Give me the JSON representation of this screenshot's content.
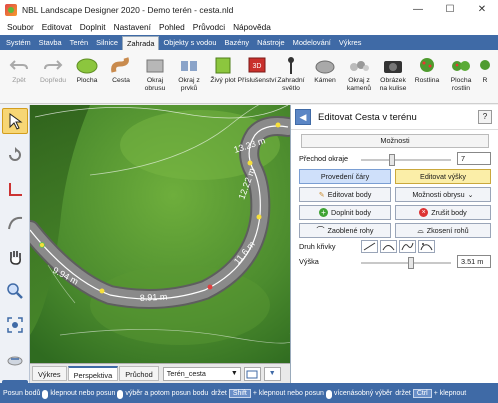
{
  "window": {
    "title": "NBL Landscape Designer 2020 - Demo terén - cesta.nld",
    "min_icon": "minimize-icon",
    "max_icon": "maximize-icon",
    "close_icon": "close-icon"
  },
  "menu": [
    "Soubor",
    "Editovat",
    "Doplnit",
    "Nastavení",
    "Pohled",
    "Průvodci",
    "Nápověda"
  ],
  "ribbon_tabs": [
    "Systém",
    "Stavba",
    "Terén",
    "Silnice",
    "Zahrada",
    "Objekty s vodou",
    "Bazény",
    "Nástroje",
    "Modelování",
    "Výkres"
  ],
  "active_ribbon_tab": "Zahrada",
  "toolbar": [
    {
      "label": "Zpět",
      "icon": "undo-icon",
      "disabled": true
    },
    {
      "label": "Dopředu",
      "icon": "redo-icon",
      "disabled": true
    },
    {
      "label": "Plocha",
      "icon": "area-icon"
    },
    {
      "label": "Cesta",
      "icon": "path-icon"
    },
    {
      "label": "Okraj obrusu",
      "icon": "curb-icon"
    },
    {
      "label": "Okraj z prvků",
      "icon": "edge-elements-icon"
    },
    {
      "label": "Živý plot",
      "icon": "hedge-icon"
    },
    {
      "label": "Příslušenství",
      "icon": "accessories-icon"
    },
    {
      "label": "Zahradní světlo",
      "icon": "garden-light-icon"
    },
    {
      "label": "Kámen",
      "icon": "stone-icon"
    },
    {
      "label": "Okraj z kamenů",
      "icon": "stone-edge-icon"
    },
    {
      "label": "Obrázek na kulise",
      "icon": "camera-icon"
    },
    {
      "label": "Rostlina",
      "icon": "plant-icon"
    },
    {
      "label": "Plocha rostlin",
      "icon": "plant-area-icon"
    },
    {
      "label": "R",
      "icon": "more-icon"
    }
  ],
  "left_tools": [
    "select-arrow-icon",
    "rotate-icon",
    "corner-icon",
    "curve-icon",
    "pan-hand-icon",
    "zoom-in-icon",
    "zoom-fit-icon",
    "orbit-icon",
    "grid-icon"
  ],
  "viewport": {
    "measurements": [
      "13.23 m",
      "12.22 m",
      "11.6 m",
      "8.91 m",
      "9.94 m"
    ]
  },
  "view_tabs": [
    "Výkres",
    "Perspektiva",
    "Průchod"
  ],
  "active_view_tab": "Perspektiva",
  "scene_select": "Terén_cesta",
  "panel": {
    "title": "Editovat Cesta v terénu",
    "help": "?",
    "section": "Možnosti",
    "edge_transition_label": "Přechod okraje",
    "edge_transition_value": "7",
    "edge_transition_level": 0.35,
    "btn_lines": "Provedení čáry",
    "btn_heights": "Editovat výšky",
    "btn_edit_points": "Editovat body",
    "btn_shape_options": "Možnosti obrysu",
    "btn_add_points": "Doplnit body",
    "btn_remove_points": "Zrušit body",
    "btn_round_corners": "Zaoblené rohy",
    "btn_sharp_corners": "Zkosení rohů",
    "curve_type_label": "Druh křivky",
    "height_label": "Výška",
    "height_value": "3.51 m",
    "height_level": 0.55
  },
  "statusbar": {
    "parts": [
      "Posun bodů",
      "klepnout nebo posun",
      "výběr a potom posun bodu",
      "držet",
      "Shift",
      "+ klepnout nebo posun",
      "vícenásobný výběr",
      "držet",
      "Ctrl",
      "+ klepnout"
    ]
  },
  "colors": {
    "accent": "#3f6aa6",
    "grass": "#4c8c2e",
    "path": "#7a7a7a",
    "active_tool": "#f7d675"
  }
}
